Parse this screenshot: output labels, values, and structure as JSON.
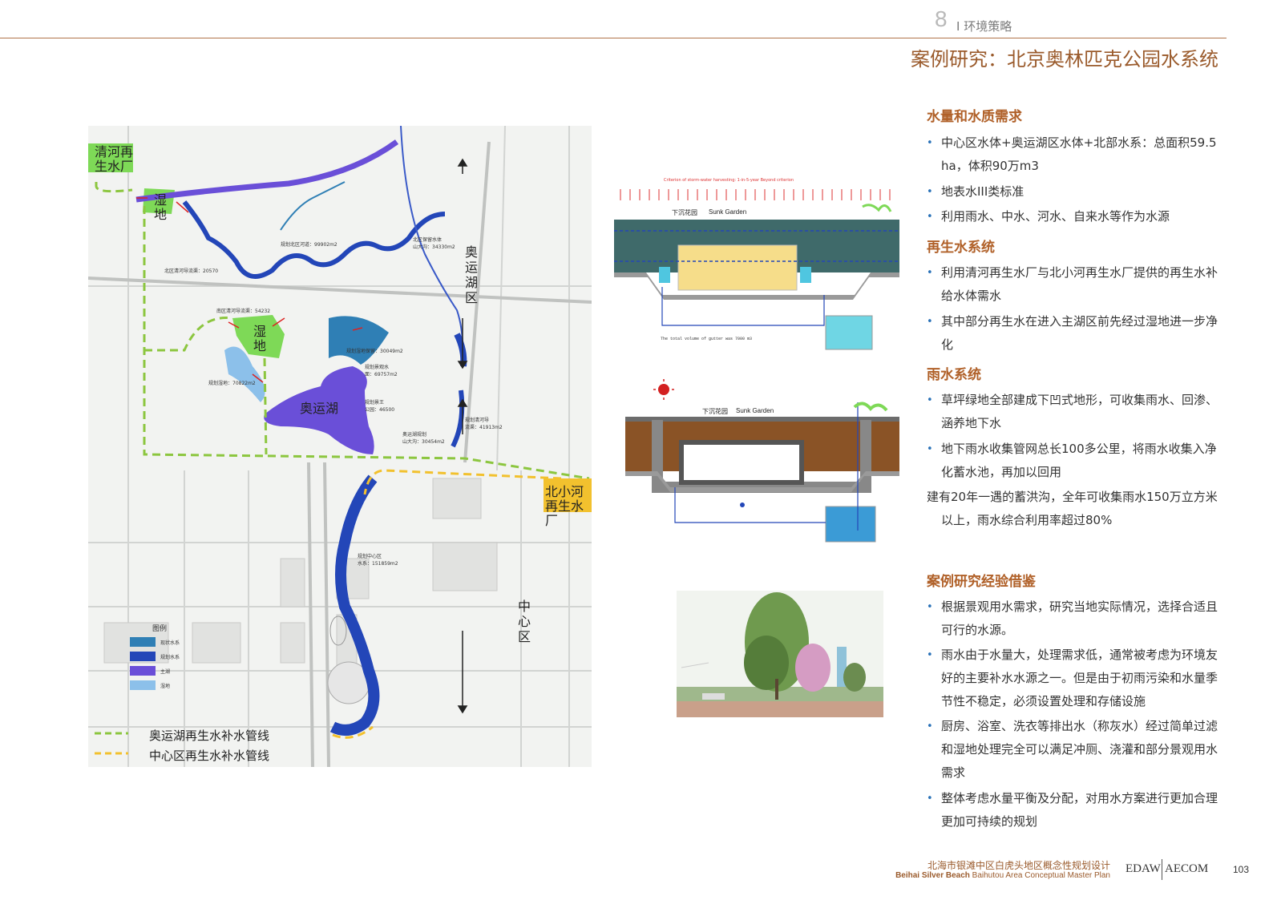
{
  "header": {
    "chapter_number": "8",
    "chapter_title": "I 环境策略",
    "page_title": "案例研究：北京奥林匹克公园水系统"
  },
  "map": {
    "labels": {
      "qinghe": "清河再\n生水厂",
      "wetland1": "湿\n地",
      "wetland2": "湿\n地",
      "aoyun_lake": "奥运湖",
      "aoyun_district": "奥运湖区",
      "beixiaohe": "北小河\n再生水\n厂",
      "center_district": "中心区"
    },
    "small_labels": {
      "a": "规划北区河道：99902m2",
      "b": "北区保留水体\n山大沟：34330m2",
      "c": "北区清河导流渠：20570",
      "d": "南区清河导流渠：54232",
      "e": "规划湿地：70822m2",
      "f": "规划湿地保留：30049m2",
      "g": "规划景观水\n面：69757m2",
      "h": "规划景王\n公园：46500",
      "i": "规划清河导\n流渠：41913m2",
      "j": "奥运湖规划\n山大沟：30454m2",
      "k": "规划中心区\n水系：151859m2"
    },
    "map_legend": {
      "title": "图例",
      "items": [
        "现状水系",
        "规划水系",
        "主湖",
        "湿地"
      ],
      "colors": [
        "#2f7fb5",
        "#2346b8",
        "#6a4fd8",
        "#8cc0ea"
      ]
    },
    "pipe_legend": [
      {
        "label": "奥运湖再生水补水管线",
        "color": "#8cc63f"
      },
      {
        "label": "中心区再生水补水管线",
        "color": "#f2c12e"
      }
    ]
  },
  "diagram1": {
    "top_caption": "Criterion of storm-water harvesting: 1-in-5-year   Beyond criterion",
    "garden_label": "下沉花园",
    "garden_en": "Sunk Garden",
    "bottom_caption": "The total volume of gutter was 7000 m3"
  },
  "diagram2": {
    "garden_label": "下沉花园",
    "garden_en": "Sunk Garden"
  },
  "sections": {
    "water_demand": {
      "heading": "水量和水质需求",
      "items": [
        "中心区水体+奥运湖区水体+北部水系：总面积59.5 ha，体积90万m3",
        "地表水III类标准",
        "利用雨水、中水、河水、自来水等作为水源"
      ]
    },
    "recycled": {
      "heading": "再生水系统",
      "items": [
        "利用清河再生水厂与北小河再生水厂提供的再生水补给水体需水",
        "其中部分再生水在进入主湖区前先经过湿地进一步净化"
      ]
    },
    "rain": {
      "heading": "雨水系统",
      "items": [
        "草坪绿地全部建成下凹式地形，可收集雨水、回渗、涵养地下水",
        "地下雨水收集管网总长100多公里，将雨水收集入净化蓄水池，再加以回用"
      ],
      "plain": "建有20年一遇的蓄洪沟，全年可收集雨水150万立方米以上，雨水综合利用率超过80%"
    },
    "lessons": {
      "heading": "案例研究经验借鉴",
      "items": [
        "根据景观用水需求，研究当地实际情况，选择合适且可行的水源。",
        "雨水由于水量大，处理需求低，通常被考虑为环境友好的主要补水水源之一。但是由于初雨污染和水量季节性不稳定，必须设置处理和存储设施",
        "厨房、浴室、洗衣等排出水（称灰水）经过简单过滤和湿地处理完全可以满足冲厕、浇灌和部分景观用水需求",
        "整体考虑水量平衡及分配，对用水方案进行更加合理更加可持续的规划"
      ]
    }
  },
  "footer": {
    "cn": "北海市银滩中区白虎头地区概念性规划设计",
    "en_bold": "Beihai Silver Beach",
    "en_rest": " Baihutou Area Conceptual Master Plan",
    "logo1": "EDAW",
    "logo2": "AECOM",
    "page": "103"
  }
}
